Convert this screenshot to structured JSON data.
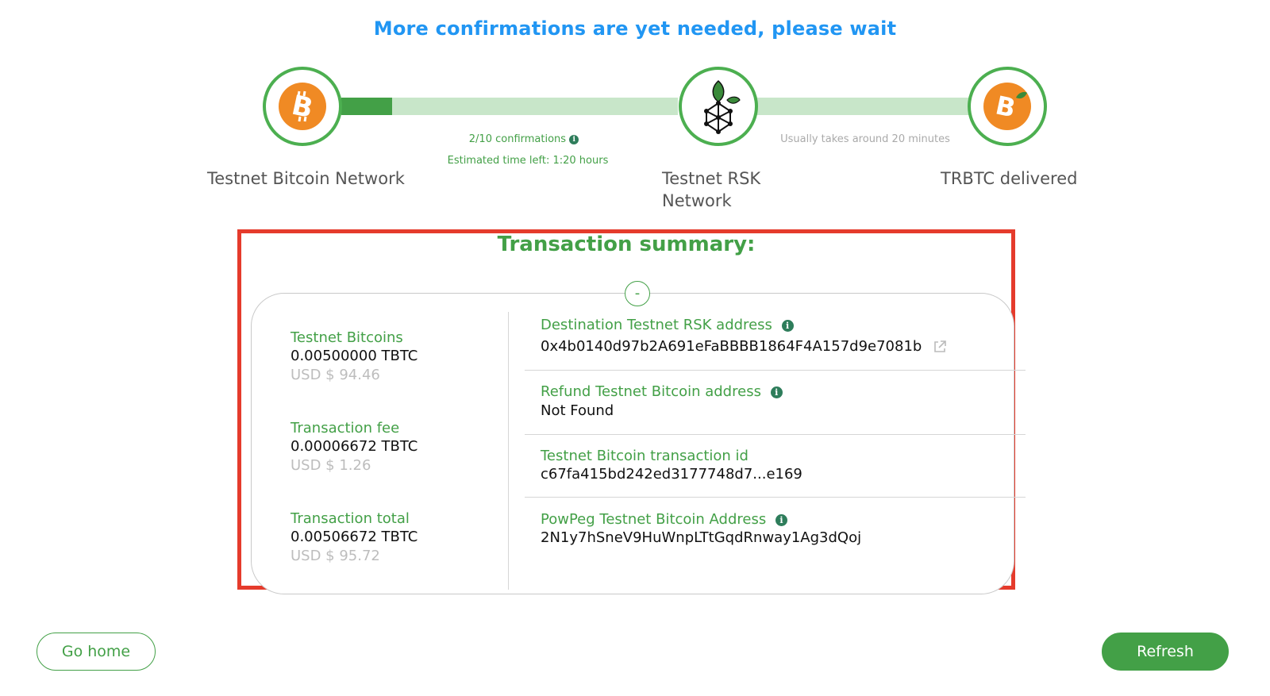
{
  "header": {
    "title": "More confirmations are yet needed, please wait"
  },
  "progress": {
    "fill_fraction": 0.15,
    "steps": [
      {
        "label": "Testnet Bitcoin Network",
        "icon": "bitcoin-icon"
      },
      {
        "label": "Testnet RSK Network",
        "icon": "rsk-icon"
      },
      {
        "label": "TRBTC delivered",
        "icon": "rbtc-icon"
      }
    ],
    "confirmations": "2/10 confirmations",
    "estimated": "Estimated time left: 1:20 hours",
    "usual_time": "Usually takes around 20 minutes"
  },
  "summary": {
    "title": "Transaction summary:",
    "toggle": "-",
    "left": [
      {
        "label": "Testnet Bitcoins",
        "value": "0.00500000 TBTC",
        "usd": "USD $ 94.46"
      },
      {
        "label": "Transaction fee",
        "value": "0.00006672 TBTC",
        "usd": "USD $ 1.26"
      },
      {
        "label": "Transaction total",
        "value": "0.00506672 TBTC",
        "usd": "USD $ 95.72"
      }
    ],
    "right": [
      {
        "label": "Destination Testnet RSK address",
        "value": "0x4b0140d97b2A691eFaBBBB1864F4A157d9e7081b"
      },
      {
        "label": "Refund Testnet Bitcoin address",
        "value": "Not Found"
      },
      {
        "label": "Testnet Bitcoin transaction id",
        "value": "c67fa415bd242ed3177748d7...e169"
      },
      {
        "label": "PowPeg Testnet Bitcoin Address",
        "value": "2N1y7hSneV9HuWnpLTtGqdRnway1Ag3dQoj"
      }
    ]
  },
  "buttons": {
    "home": "Go home",
    "refresh": "Refresh"
  },
  "colors": {
    "accent": "#43a047",
    "title_blue": "#2196f3",
    "highlight": "#e53b2c",
    "bitcoin": "#f08a24"
  }
}
